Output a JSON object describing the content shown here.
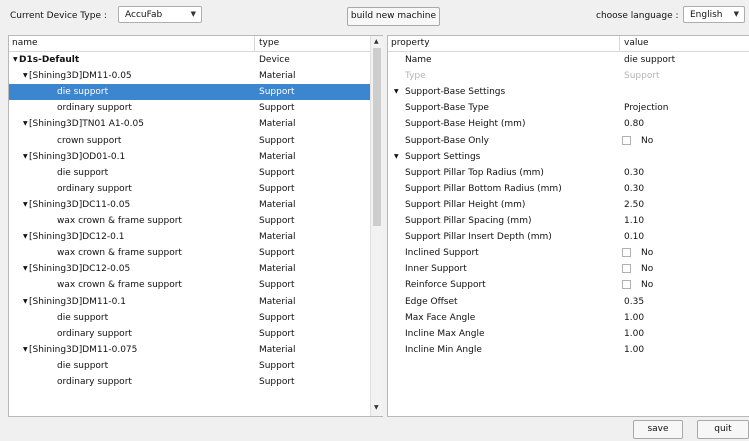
{
  "toolbar": {
    "device_type_label": "Current Device Type :",
    "device_value": "AccuFab",
    "build_label": "build new machine",
    "language_label": "choose language :",
    "language_value": "English"
  },
  "tree": {
    "headers": {
      "name": "name",
      "type": "type"
    },
    "rows": [
      {
        "name": "D1s-Default",
        "type": "Device",
        "level": 0,
        "expand": "open",
        "bold": true
      },
      {
        "name": "[Shining3D]DM11-0.05",
        "type": "Material",
        "level": 1,
        "expand": "open"
      },
      {
        "name": "die support",
        "type": "Support",
        "level": 2,
        "selected": true
      },
      {
        "name": "ordinary support",
        "type": "Support",
        "level": 2
      },
      {
        "name": "[Shining3D]TN01 A1-0.05",
        "type": "Material",
        "level": 1,
        "expand": "open"
      },
      {
        "name": "crown support",
        "type": "Support",
        "level": 2
      },
      {
        "name": "[Shining3D]OD01-0.1",
        "type": "Material",
        "level": 1,
        "expand": "open"
      },
      {
        "name": "die support",
        "type": "Support",
        "level": 2
      },
      {
        "name": "ordinary support",
        "type": "Support",
        "level": 2
      },
      {
        "name": "[Shining3D]DC11-0.05",
        "type": "Material",
        "level": 1,
        "expand": "open"
      },
      {
        "name": "wax crown & frame support",
        "type": "Support",
        "level": 2
      },
      {
        "name": "[Shining3D]DC12-0.1",
        "type": "Material",
        "level": 1,
        "expand": "open"
      },
      {
        "name": "wax crown & frame support",
        "type": "Support",
        "level": 2
      },
      {
        "name": "[Shining3D]DC12-0.05",
        "type": "Material",
        "level": 1,
        "expand": "open"
      },
      {
        "name": "wax crown & frame support",
        "type": "Support",
        "level": 2
      },
      {
        "name": "[Shining3D]DM11-0.1",
        "type": "Material",
        "level": 1,
        "expand": "open"
      },
      {
        "name": "die support",
        "type": "Support",
        "level": 2
      },
      {
        "name": "ordinary support",
        "type": "Support",
        "level": 2
      },
      {
        "name": "[Shining3D]DM11-0.075",
        "type": "Material",
        "level": 1,
        "expand": "open"
      },
      {
        "name": "die support",
        "type": "Support",
        "level": 2
      },
      {
        "name": "ordinary support",
        "type": "Support",
        "level": 2
      }
    ]
  },
  "props": {
    "headers": {
      "property": "property",
      "value": "value"
    },
    "rows": [
      {
        "kind": "prop",
        "name": "Name",
        "value": "die support"
      },
      {
        "kind": "prop",
        "name": "Type",
        "value": "Support",
        "disabled": true
      },
      {
        "kind": "group",
        "name": "Support-Base Settings"
      },
      {
        "kind": "prop",
        "name": "Support-Base Type",
        "value": "Projection"
      },
      {
        "kind": "prop",
        "name": "Support-Base Height (mm)",
        "value": "0.80"
      },
      {
        "kind": "check",
        "name": "Support-Base Only",
        "value": "No"
      },
      {
        "kind": "group",
        "name": "Support Settings"
      },
      {
        "kind": "prop",
        "name": "Support Pillar Top Radius (mm)",
        "value": "0.30"
      },
      {
        "kind": "prop",
        "name": "Support Pillar Bottom Radius (mm)",
        "value": "0.30"
      },
      {
        "kind": "prop",
        "name": "Support Pillar Height (mm)",
        "value": "2.50"
      },
      {
        "kind": "prop",
        "name": "Support Pillar Spacing (mm)",
        "value": "1.10"
      },
      {
        "kind": "prop",
        "name": "Support Pillar Insert Depth (mm)",
        "value": "0.10"
      },
      {
        "kind": "check",
        "name": "Inclined Support",
        "value": "No"
      },
      {
        "kind": "check",
        "name": "Inner Support",
        "value": "No"
      },
      {
        "kind": "check",
        "name": "Reinforce Support",
        "value": "No"
      },
      {
        "kind": "prop",
        "name": "Edge Offset",
        "value": "0.35"
      },
      {
        "kind": "prop",
        "name": "Max Face Angle",
        "value": "1.00"
      },
      {
        "kind": "prop",
        "name": "Incline Max Angle",
        "value": "1.00"
      },
      {
        "kind": "prop",
        "name": "Incline Min Angle",
        "value": "1.00"
      }
    ]
  },
  "footer": {
    "save_label": "save",
    "quit_label": "quit"
  },
  "colors": {
    "selection": "#3b86cf",
    "disabled_text": "#b5b5b5"
  }
}
